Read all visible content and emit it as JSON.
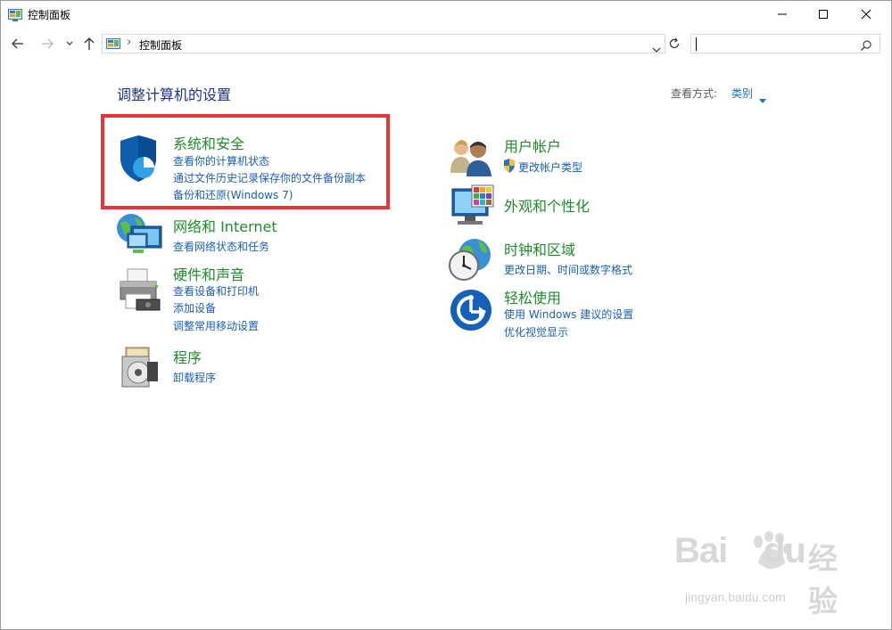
{
  "window": {
    "title": "控制面板",
    "icons": {
      "app": "control-panel-icon",
      "minimize": "minimize-icon",
      "maximize": "maximize-icon",
      "close": "close-icon"
    }
  },
  "nav": {
    "breadcrumb": "控制面板",
    "breadcrumb_separator": "›",
    "search_placeholder": ""
  },
  "main": {
    "heading": "调整计算机的设置",
    "view_by_label": "查看方式:",
    "view_by_value": "类别"
  },
  "categories_left": [
    {
      "title": "系统和安全",
      "icon": "shield-icon",
      "links": [
        "查看你的计算机状态",
        "通过文件历史记录保存你的文件备份副本",
        "备份和还原(Windows 7)"
      ]
    },
    {
      "title": "网络和 Internet",
      "icon": "network-globe-icon",
      "links": [
        "查看网络状态和任务"
      ]
    },
    {
      "title": "硬件和声音",
      "icon": "printer-icon",
      "links": [
        "查看设备和打印机",
        "添加设备",
        "调整常用移动设置"
      ]
    },
    {
      "title": "程序",
      "icon": "programs-disc-icon",
      "links": [
        "卸载程序"
      ]
    }
  ],
  "categories_right": [
    {
      "title": "用户帐户",
      "icon": "users-icon",
      "links": [
        "更改帐户类型"
      ]
    },
    {
      "title": "外观和个性化",
      "icon": "monitor-palette-icon",
      "links": []
    },
    {
      "title": "时钟和区域",
      "icon": "clock-globe-icon",
      "links": [
        "更改日期、时间或数字格式"
      ]
    },
    {
      "title": "轻松使用",
      "icon": "ease-of-access-icon",
      "links": [
        "使用 Windows 建议的设置",
        "优化视觉显示"
      ]
    }
  ],
  "watermark": {
    "logo_left": "Bai",
    "logo_right": "du",
    "logo_cn": "经验",
    "url": "jingyan.baidu.com"
  },
  "colors": {
    "category_title": "#1e8c2a",
    "link": "#1a5fb4",
    "heading": "#1e3287",
    "highlight_border": "#e3373a"
  }
}
